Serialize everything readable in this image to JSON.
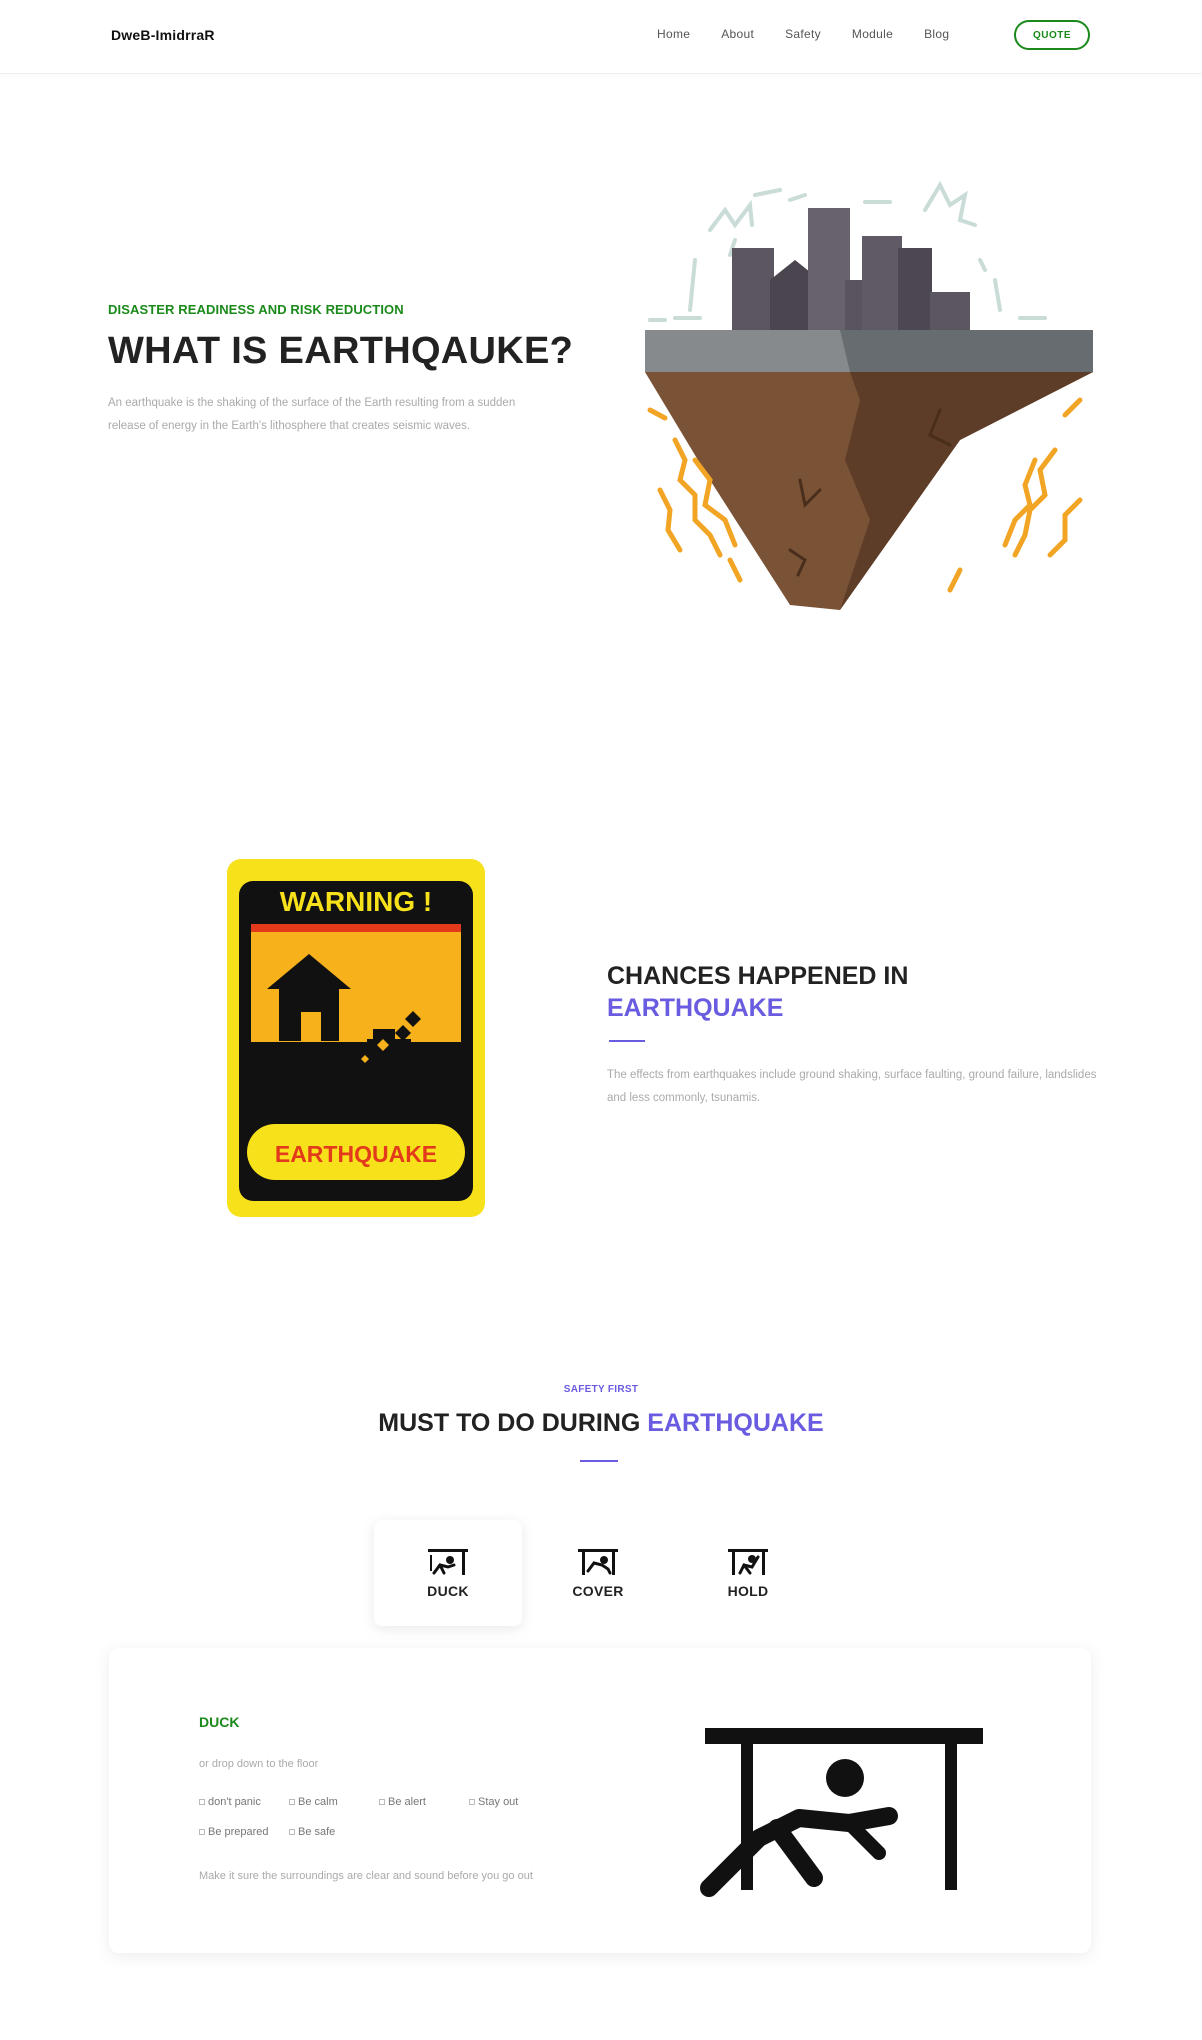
{
  "header": {
    "logo": "DweB-ImidrraR",
    "nav": [
      "Home",
      "About",
      "Safety",
      "Module",
      "Blog"
    ],
    "quote_label": "QUOTE"
  },
  "hero": {
    "eyebrow": "DISASTER READINESS AND RISK REDUCTION",
    "title": "WHAT IS EARTHQAUKE?",
    "text": "An earthquake is the shaking of the surface of the Earth resulting from a sudden release of energy in the Earth's lithosphere that creates seismic waves."
  },
  "warning_sign": {
    "header": "WARNING !",
    "label": "EARTHQUAKE"
  },
  "chances": {
    "title_line1": "CHANCES HAPPENED IN",
    "title_accent": "EARTHQUAKE",
    "text": "The effects from earthquakes include ground shaking, surface faulting, ground failure, landslides and less commonly, tsunamis."
  },
  "must_do": {
    "eyebrow": "SAFETY FIRST",
    "title_main": "MUST TO DO DURING ",
    "title_accent": "EARTHQUAKE",
    "tabs": [
      {
        "label": "DUCK",
        "icon": "duck-icon",
        "active": true
      },
      {
        "label": "COVER",
        "icon": "cover-icon",
        "active": false
      },
      {
        "label": "HOLD",
        "icon": "hold-icon",
        "active": false
      }
    ],
    "panel": {
      "title": "DUCK",
      "subtitle": "or drop down to the floor",
      "tips": [
        "don't panic",
        "Be calm",
        "Be alert",
        "Stay out",
        "Be prepared",
        "Be safe"
      ],
      "note": "Make it sure the surroundings are clear and sound before you go out"
    }
  },
  "colors": {
    "green": "#1a8a1a",
    "purple": "#6a5ce0",
    "warning_yellow": "#f7e11a",
    "warning_orange": "#f7b11a",
    "warning_red": "#e23a1a"
  }
}
